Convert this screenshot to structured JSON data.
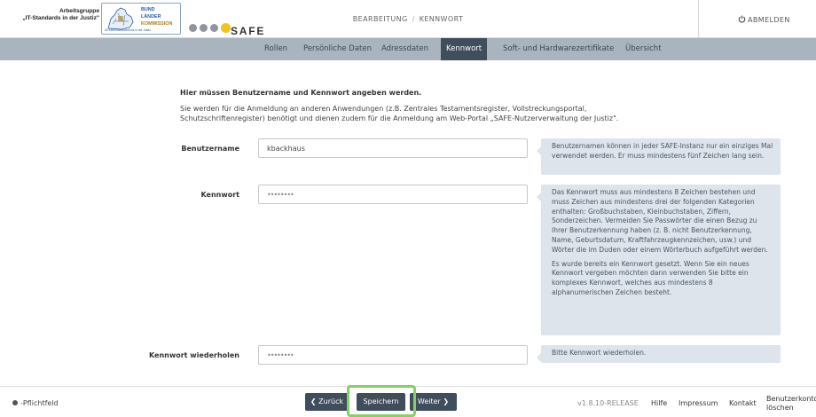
{
  "header": {
    "org_line1": "Arbeitsgruppe",
    "org_line2": "„IT-Standards in der Justiz\"",
    "logo_words": [
      "BUND",
      "LÄNDER",
      "KOMMISSION"
    ],
    "logo_sub": "für Informationstechnik in der Justiz",
    "dots": [
      "#8e959c",
      "#8e959c",
      "#8e959c",
      "#f2c31b"
    ],
    "app_title": "SAFE",
    "breadcrumb": [
      "BEARBEITUNG",
      "KENNWORT"
    ],
    "logout_label": "ABMELDEN",
    "logout_icon": "power-icon"
  },
  "tabs": [
    {
      "label": "Rollen",
      "active": false
    },
    {
      "label": "Persönliche Daten",
      "active": false
    },
    {
      "label": "Adressdaten",
      "active": false
    },
    {
      "label": "Kennwort",
      "active": true
    },
    {
      "label": "Soft- und Hardwarezertifikate",
      "active": false
    },
    {
      "label": "Übersicht",
      "active": false
    }
  ],
  "intro": {
    "title": "Hier müssen Benutzername und Kennwort angeben werden.",
    "text": "Sie werden für die Anmeldung an anderen Anwendungen (z.B. Zentrales Testamentsregister, Vollstreckungsportal, Schutzschriftenregister) benötigt und dienen zudem für die Anmeldung am Web-Portal „SAFE-Nutzerverwaltung der Justiz\"."
  },
  "form": {
    "username": {
      "label": "Benutzername",
      "value": "kbackhaus",
      "hint": "Benutzernamen können in jeder SAFE-Instanz nur ein einziges Mal verwendet werden. Er muss mindestens fünf Zeichen lang sein."
    },
    "password": {
      "label": "Kennwort",
      "value": "••••••••",
      "hint1": "Das Kennwort muss aus mindestens 8 Zeichen bestehen und muss Zeichen aus mindestens drei der folgenden Kategorien enthalten: Großbuchstaben, Kleinbuchstaben, Ziffern, Sonderzeichen. Vermeiden Sie Passwörter die einen Bezug zu Ihrer Benutzerkennung haben (z. B. nicht Benutzerkennung, Name, Geburtsdatum, Kraftfahrzeugkennzeichen, usw.) und Wörter die im Duden oder einem Wörterbuch aufgeführt werden.",
      "hint2": "Es wurde bereits ein Kennwort gesetzt. Wenn Sie ein neues Kennwort vergeben möchten dann verwenden Sie bitte ein komplexes Kennwort, welches aus mindestens 8 alphanumerischen Zeichen besteht."
    },
    "password_repeat": {
      "label": "Kennwort wiederholen",
      "value": "••••••••",
      "hint": "Bitte Kennwort wiederholen."
    }
  },
  "footer": {
    "required_label": "-Pflichtfeld",
    "back_label": "❮ Zurück",
    "save_label": "Speichern",
    "next_label": "Weiter ❯",
    "version": "v1.8.10-RELEASE",
    "links": [
      "Hilfe",
      "Impressum",
      "Kontakt",
      "Benutzerkonto löschen"
    ]
  }
}
